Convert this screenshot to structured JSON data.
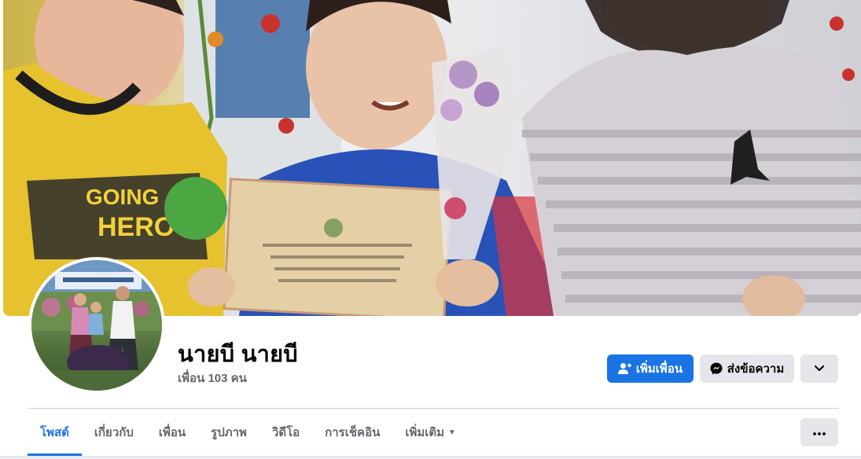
{
  "profile": {
    "name": "นายบี นายบี",
    "friends_count": "เพื่อน 103 คน"
  },
  "actions": {
    "add_friend_label": "เพิ่มเพื่อน",
    "message_label": "ส่งข้อความ"
  },
  "tabs": [
    {
      "label": "โพสต์",
      "active": true
    },
    {
      "label": "เกี่ยวกับ",
      "active": false
    },
    {
      "label": "เพื่อน",
      "active": false
    },
    {
      "label": "รูปภาพ",
      "active": false
    },
    {
      "label": "วิดีโอ",
      "active": false
    },
    {
      "label": "การเช็คอิน",
      "active": false
    },
    {
      "label": "เพิ่มเติม",
      "active": false
    }
  ],
  "colors": {
    "accent": "#1b74e4",
    "secondary_button": "#e4e6eb",
    "muted_text": "#65676b"
  },
  "icons": {
    "add_friend": "person-plus-icon",
    "message": "messenger-icon",
    "more": "chevron-down-icon",
    "tab_more": "caret-down-icon",
    "options": "ellipsis-icon"
  }
}
